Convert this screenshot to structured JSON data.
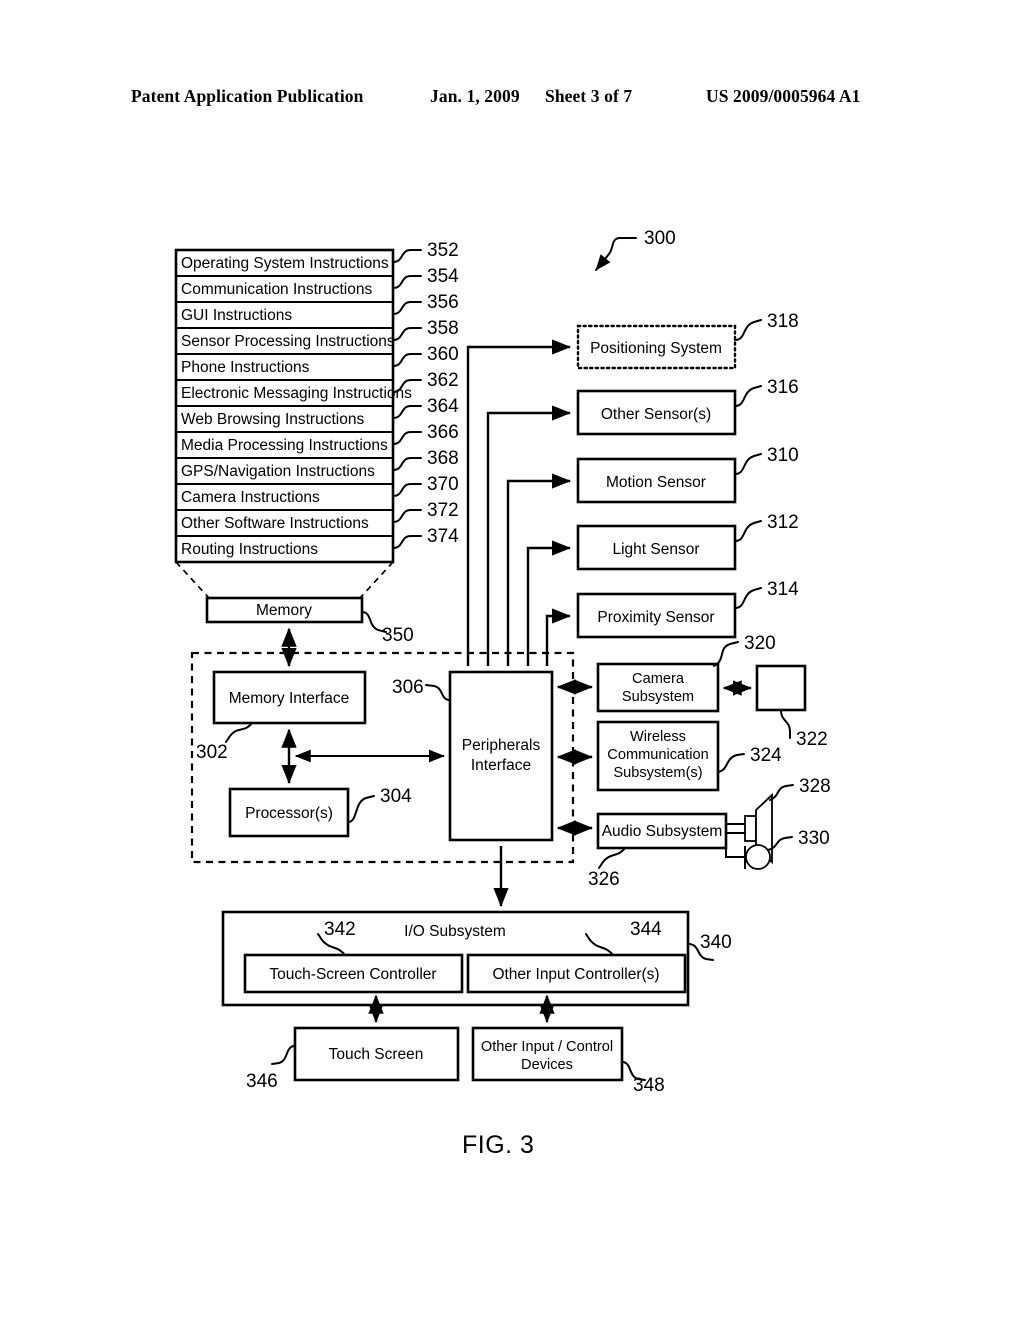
{
  "header": {
    "publication": "Patent Application Publication",
    "date": "Jan. 1, 2009",
    "sheet": "Sheet 3 of 7",
    "patent_number": "US 2009/0005964 A1"
  },
  "figure": {
    "caption": "FIG. 3",
    "system_ref": "300"
  },
  "memory_instructions": {
    "container_ref": "350",
    "container_label": "Memory",
    "rows": [
      {
        "label": "Operating System Instructions",
        "ref": "352"
      },
      {
        "label": "Communication Instructions",
        "ref": "354"
      },
      {
        "label": "GUI Instructions",
        "ref": "356"
      },
      {
        "label": "Sensor Processing Instructions",
        "ref": "358"
      },
      {
        "label": "Phone Instructions",
        "ref": "360"
      },
      {
        "label": "Electronic Messaging Instructions",
        "ref": "362"
      },
      {
        "label": "Web Browsing Instructions",
        "ref": "364"
      },
      {
        "label": "Media Processing Instructions",
        "ref": "366"
      },
      {
        "label": "GPS/Navigation Instructions",
        "ref": "368"
      },
      {
        "label": "Camera Instructions",
        "ref": "370"
      },
      {
        "label": "Other Software Instructions",
        "ref": "372"
      },
      {
        "label": "Routing Instructions",
        "ref": "374"
      }
    ]
  },
  "sensors": [
    {
      "label": "Positioning System",
      "ref": "318",
      "style": "dotted"
    },
    {
      "label": "Other Sensor(s)",
      "ref": "316",
      "style": "solid"
    },
    {
      "label": "Motion Sensor",
      "ref": "310",
      "style": "solid"
    },
    {
      "label": "Light Sensor",
      "ref": "312",
      "style": "solid"
    },
    {
      "label": "Proximity Sensor",
      "ref": "314",
      "style": "solid"
    }
  ],
  "core": {
    "enclosure_ref": "302",
    "memory_interface": {
      "label": "Memory Interface",
      "ref": "302"
    },
    "processor": {
      "label": "Processor(s)",
      "ref": "304"
    },
    "peripherals": {
      "label_line1": "Peripherals",
      "label_line2": "Interface",
      "ref": "306"
    }
  },
  "subsystems": {
    "camera": {
      "label_line1": "Camera",
      "label_line2": "Subsystem",
      "ref": "320"
    },
    "optical": {
      "label": "",
      "ref": "322"
    },
    "wireless": {
      "label_line1": "Wireless",
      "label_line2": "Communication",
      "label_line3": "Subsystem(s)",
      "ref": "324"
    },
    "audio": {
      "label": "Audio Subsystem",
      "ref": "326"
    },
    "speaker": {
      "ref": "328"
    },
    "microphone": {
      "ref": "330"
    }
  },
  "io_subsystem": {
    "title": "I/O Subsystem",
    "ref": "340",
    "touch_screen_controller": {
      "label": "Touch-Screen Controller",
      "ref": "342"
    },
    "other_input_controller": {
      "label": "Other Input Controller(s)",
      "ref": "344"
    },
    "touch_screen": {
      "label": "Touch Screen",
      "ref": "346"
    },
    "other_input_devices": {
      "label_line1": "Other Input / Control",
      "label_line2": "Devices",
      "ref": "348"
    }
  },
  "colors": {
    "ink": "#000000",
    "paper": "#ffffff"
  }
}
